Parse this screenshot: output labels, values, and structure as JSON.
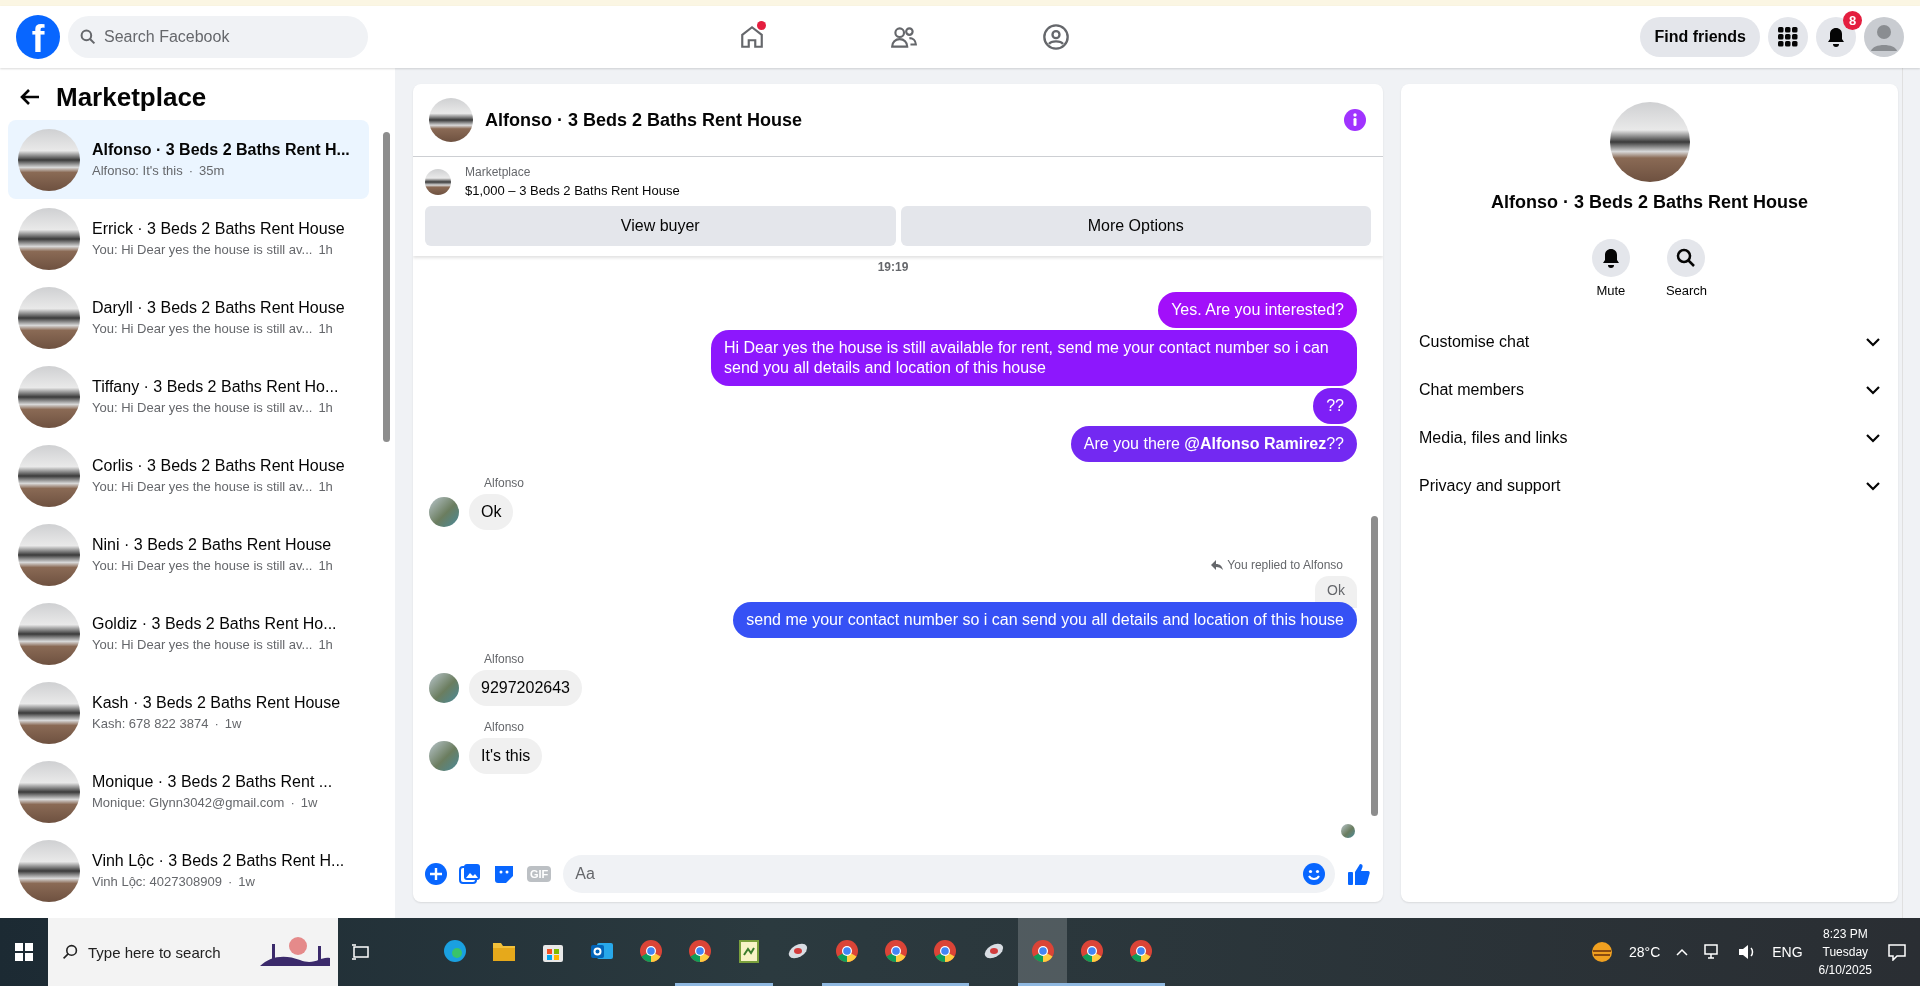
{
  "top_nav": {
    "logo": "f",
    "search_placeholder": "Search Facebook",
    "nav_tabs": [
      {
        "kind": "home",
        "dot": true
      },
      {
        "kind": "friends",
        "dot": false
      },
      {
        "kind": "groups",
        "dot": false
      }
    ],
    "find_friends": "Find friends",
    "notifications_badge": "8"
  },
  "sidebar": {
    "title": "Marketplace",
    "conversations": [
      {
        "title": "Alfonso · 3 Beds 2 Baths Rent H...",
        "preview": "Alfonso: It's this",
        "separator": "·",
        "time": "35m",
        "selected": true
      },
      {
        "title": "Errick · 3 Beds 2 Baths Rent House",
        "preview": "You: Hi Dear yes the house is still av...",
        "time": "1h",
        "selected": false
      },
      {
        "title": "Daryll · 3 Beds 2 Baths Rent House",
        "preview": "You: Hi Dear yes the house is still av...",
        "time": "1h",
        "selected": false
      },
      {
        "title": "Tiffany · 3 Beds 2 Baths Rent Ho...",
        "preview": "You: Hi Dear yes the house is still av...",
        "time": "1h",
        "selected": false
      },
      {
        "title": "Corlis · 3 Beds 2 Baths Rent House",
        "preview": "You: Hi Dear yes the house is still av...",
        "time": "1h",
        "selected": false
      },
      {
        "title": "Nini · 3 Beds 2 Baths Rent House",
        "preview": "You: Hi Dear yes the house is still av...",
        "time": "1h",
        "selected": false
      },
      {
        "title": "Goldiz · 3 Beds 2 Baths Rent Ho...",
        "preview": "You: Hi Dear yes the house is still av...",
        "time": "1h",
        "selected": false
      },
      {
        "title": "Kash · 3 Beds 2 Baths Rent House",
        "preview": "Kash: 678 822 3874",
        "separator": "·",
        "time": "1w",
        "selected": false
      },
      {
        "title": "Monique · 3 Beds 2 Baths Rent ...",
        "preview": "Monique: Glynn3042@gmail.com",
        "separator": "·",
        "time": "1w",
        "selected": false
      },
      {
        "title": "Vinh Lộc · 3 Beds 2 Baths Rent H...",
        "preview": "Vinh Lộc: 4027308909",
        "separator": "·",
        "time": "1w",
        "selected": false
      }
    ]
  },
  "chat": {
    "title": "Alfonso · 3 Beds 2 Baths Rent House",
    "listing": {
      "label": "Marketplace",
      "title": "$1,000 – 3 Beds 2 Baths Rent House"
    },
    "buttons": [
      "View buyer",
      "More Options"
    ],
    "timestamp": "19:19",
    "messages": [
      {
        "kind": "outgoing",
        "text": "Yes. Are you interested?",
        "color": "#a20ffa"
      },
      {
        "kind": "outgoing",
        "text": "Hi Dear yes the house is still available for rent, send me your contact number so i can send you all details and location of this house",
        "color": "#8d17fd"
      },
      {
        "kind": "outgoing",
        "text": "??",
        "color": "#7e1ff6"
      },
      {
        "kind": "outgoing",
        "text": "Are you there **@Alfonso Ramirez**??",
        "color": "#7329f2"
      },
      {
        "kind": "incoming",
        "sender": "Alfonso",
        "text": "Ok"
      },
      {
        "kind": "reply",
        "note": "You replied to Alfonso",
        "quote": "Ok",
        "text": "send me your contact number so i can send you all details and location of this house",
        "color": "#3651f5"
      },
      {
        "kind": "incoming",
        "sender": "Alfonso",
        "text": "9297202643"
      },
      {
        "kind": "incoming",
        "sender": "Alfonso",
        "text": "It's this"
      }
    ],
    "composer": {
      "gif": "GIF",
      "placeholder": "Aa"
    }
  },
  "details": {
    "title": "Alfonso · 3 Beds 2 Baths Rent House",
    "actions": [
      {
        "kind": "mute",
        "label": "Mute"
      },
      {
        "kind": "search",
        "label": "Search"
      }
    ],
    "sections": [
      {
        "label": "Customise chat",
        "expanded": false
      },
      {
        "label": "Chat members",
        "expanded": false
      },
      {
        "label": "Media, files and links",
        "expanded": false
      },
      {
        "label": "Privacy and support",
        "expanded": false
      }
    ]
  },
  "taskbar": {
    "search_placeholder": "Type here to search",
    "apps": [
      {
        "kind": "edge",
        "running": false,
        "selected": false
      },
      {
        "kind": "folder",
        "running": false,
        "selected": false
      },
      {
        "kind": "store",
        "running": false,
        "selected": false
      },
      {
        "kind": "mail",
        "running": false,
        "selected": false
      },
      {
        "kind": "chrome",
        "running": false,
        "selected": false
      },
      {
        "kind": "chrome",
        "running": true,
        "selected": false
      },
      {
        "kind": "notepad",
        "running": true,
        "selected": false
      },
      {
        "kind": "tool",
        "running": false,
        "selected": false
      },
      {
        "kind": "chrome",
        "running": true,
        "selected": false
      },
      {
        "kind": "chrome",
        "running": true,
        "selected": false
      },
      {
        "kind": "chrome",
        "running": true,
        "selected": false
      },
      {
        "kind": "tool",
        "running": false,
        "selected": false
      },
      {
        "kind": "chrome",
        "running": true,
        "selected": true
      },
      {
        "kind": "chrome",
        "running": true,
        "selected": false
      },
      {
        "kind": "chrome",
        "running": true,
        "selected": false
      }
    ],
    "weather": "28°C",
    "language": "ENG",
    "time": "8:23 PM",
    "day": "Tuesday",
    "date": "6/10/2025"
  }
}
